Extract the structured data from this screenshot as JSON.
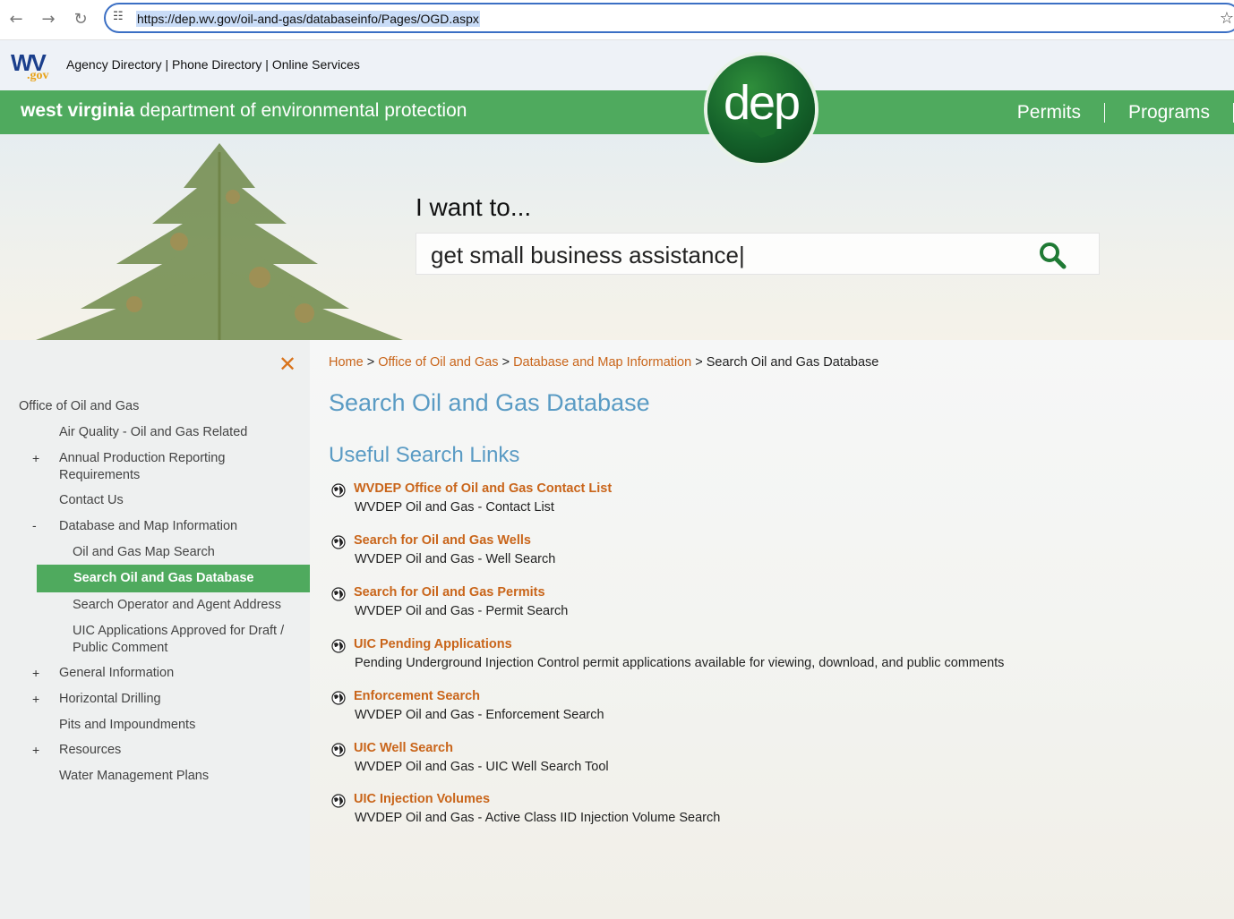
{
  "browser": {
    "url": "https://dep.wv.gov/oil-and-gas/databaseinfo/Pages/OGD.aspx"
  },
  "header": {
    "logo_wv": "WV",
    "logo_gov": ".gov",
    "utility_links": [
      "Agency Directory",
      "Phone Directory",
      "Online Services"
    ],
    "banner_bold": "west virginia",
    "banner_rest": " department of environmental protection",
    "dep_logo_text": "dep",
    "nav": [
      "Permits",
      "Programs"
    ]
  },
  "hero": {
    "want_label": "I want to...",
    "search_value": "get small business assistance|"
  },
  "sidebar": {
    "items": [
      {
        "label": "Office of Oil and Gas",
        "toggle": ""
      },
      {
        "label": "Air Quality - Oil and Gas Related",
        "toggle": ""
      },
      {
        "label": "Annual Production Reporting Requirements",
        "toggle": "+"
      },
      {
        "label": "Contact Us",
        "toggle": ""
      },
      {
        "label": "Database and Map Information",
        "toggle": "-"
      },
      {
        "label": "Oil and Gas Map Search",
        "toggle": ""
      },
      {
        "label": "Search Oil and Gas Database",
        "toggle": ""
      },
      {
        "label": "Search Operator and Agent Address",
        "toggle": ""
      },
      {
        "label": "UIC Applications Approved for Draft / Public Comment",
        "toggle": ""
      },
      {
        "label": "General Information",
        "toggle": "+"
      },
      {
        "label": "Horizontal Drilling",
        "toggle": "+"
      },
      {
        "label": "Pits and Impoundments",
        "toggle": ""
      },
      {
        "label": "Resources",
        "toggle": "+"
      },
      {
        "label": "Water Management Plans",
        "toggle": ""
      }
    ]
  },
  "main": {
    "breadcrumb": [
      "Home",
      "Office of Oil and Gas",
      "Database and Map Information",
      "Search Oil and Gas Database"
    ],
    "page_title": "Search Oil and Gas Database",
    "section_title": "Useful Search Links",
    "links": [
      {
        "title": "WVDEP Office of Oil and Gas Contact List",
        "desc": "WVDEP Oil and Gas - Contact List"
      },
      {
        "title": "Search for Oil and Gas Wells",
        "desc": "WVDEP Oil and Gas - Well Search"
      },
      {
        "title": "Search for Oil and Gas Permits",
        "desc": "WVDEP Oil and Gas - Permit Search"
      },
      {
        "title": "UIC Pending Applications",
        "desc": "Pending Underground Injection Control permit applications available for viewing, download, and public comments"
      },
      {
        "title": "Enforcement Search",
        "desc": "WVDEP Oil and Gas - Enforcement Search"
      },
      {
        "title": "UIC Well Search",
        "desc": "WVDEP Oil and Gas - UIC Well Search Tool"
      },
      {
        "title": "UIC Injection Volumes",
        "desc": "WVDEP Oil and Gas - Active Class IID Injection Volume Search"
      }
    ]
  },
  "colors": {
    "brand_green": "#4faa5e",
    "link_orange": "#c9651a",
    "heading_blue": "#5a9bc4"
  }
}
